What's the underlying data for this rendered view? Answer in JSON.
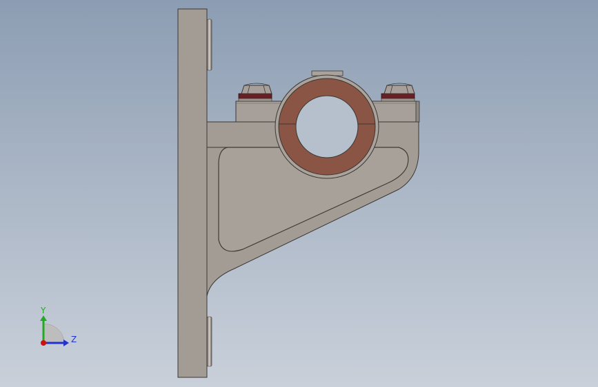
{
  "triad": {
    "y_label": "Y",
    "z_label": "Z",
    "y_color": "#22aa22",
    "z_color": "#2233cc",
    "x_color": "#cc1111"
  },
  "colors": {
    "bracket": "#a39c95",
    "bracket_edge": "#3a3632",
    "clamp_ring": "#8a5545",
    "nut": "#a7a09a",
    "washer": "#6a1f25"
  }
}
